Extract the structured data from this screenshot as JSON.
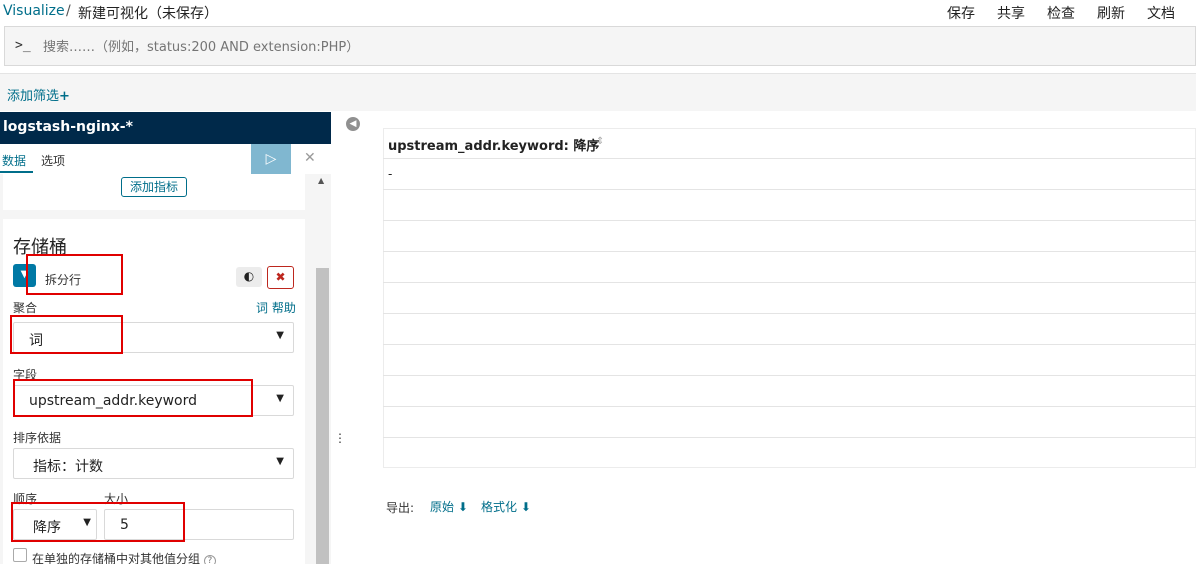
{
  "breadcrumb": {
    "root": "Visualize",
    "separator": "/",
    "current": "新建可视化（未保存）"
  },
  "top_actions": [
    "保存",
    "共享",
    "检查",
    "刷新",
    "文档"
  ],
  "query": {
    "prompt": ">_",
    "placeholder": "搜索……（例如，status:200 AND extension:PHP）"
  },
  "filter": {
    "add_label": "添加筛选",
    "add_icon": "+"
  },
  "index": {
    "name": "logstash-nginx-*"
  },
  "tabs": {
    "data": "数据",
    "options": "选项"
  },
  "run_icon": "▷",
  "close_icon": "✕",
  "metrics": {
    "add_label": "添加指标"
  },
  "bucket": {
    "title": "存储桶",
    "chevron": "▼",
    "type": "拆分行",
    "switch_icon": "◐",
    "remove_icon": "✖",
    "agg_label": "聚合",
    "agg_help": "词 帮助",
    "agg_value": "词",
    "field_label": "字段",
    "field_value": "upstream_addr.keyword",
    "order_by_label": "排序依据",
    "order_by_value": "指标：计数",
    "order_label": "顺序",
    "order_value": "降序",
    "size_label": "大小",
    "size_value": "5",
    "other_bucket_label": "在单独的存储桶中对其他值分组",
    "help_icon": "?"
  },
  "table": {
    "header": "upstream_addr.keyword: 降序",
    "sort_icon": "⇕",
    "rows": [
      "-",
      "",
      "",
      "",
      "",
      "",
      "",
      "",
      "",
      ""
    ]
  },
  "export": {
    "label": "导出:",
    "raw": "原始",
    "formatted": "格式化",
    "download_icon": "⬇"
  },
  "colors": {
    "accent": "#006e8a",
    "header_bg": "#00294a",
    "danger": "#bd271e",
    "highlight": "#e00000"
  }
}
